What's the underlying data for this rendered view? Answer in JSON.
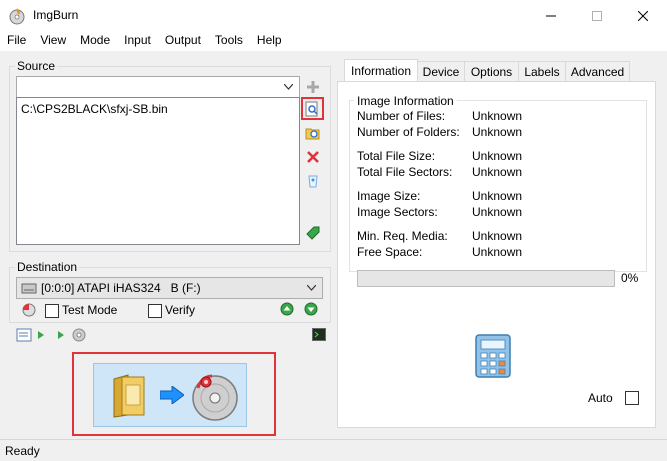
{
  "window": {
    "title": "ImgBurn"
  },
  "menu": [
    "File",
    "View",
    "Mode",
    "Input",
    "Output",
    "Tools",
    "Help"
  ],
  "source": {
    "label": "Source",
    "combo_value": "",
    "files": [
      "C:\\CPS2BLACK\\sfxj-SB.bin"
    ]
  },
  "destination": {
    "label": "Destination",
    "drive": "[0:0:0] ATAPI iHAS324   B (F:)",
    "test_mode": "Test Mode",
    "verify": "Verify"
  },
  "tabs": [
    "Information",
    "Device",
    "Options",
    "Labels",
    "Advanced"
  ],
  "info": {
    "group_label": "Image Information",
    "rows": [
      {
        "label": "Number of Files:",
        "value": "Unknown"
      },
      {
        "label": "Number of Folders:",
        "value": "Unknown"
      },
      {
        "label": "Total File Size:",
        "value": "Unknown"
      },
      {
        "label": "Total File Sectors:",
        "value": "Unknown"
      },
      {
        "label": "Image Size:",
        "value": "Unknown"
      },
      {
        "label": "Image Sectors:",
        "value": "Unknown"
      },
      {
        "label": "Min. Req. Media:",
        "value": "Unknown"
      },
      {
        "label": "Free Space:",
        "value": "Unknown"
      }
    ],
    "progress_text": "0%",
    "progress": 0,
    "auto_label": "Auto"
  },
  "status": {
    "text": "Ready"
  },
  "colors": {
    "highlight_red": "#e0343a",
    "accent_blue": "#1e90ff"
  }
}
